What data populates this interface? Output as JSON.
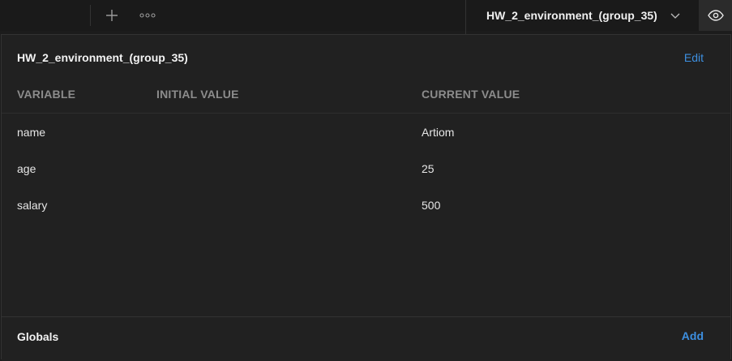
{
  "toolbar": {
    "new_tab_icon": "plus-icon",
    "more_icon": "more-horizontal-icon"
  },
  "environment_selector": {
    "selected": "HW_2_environment_(group_35)",
    "icon": "chevron-down-icon"
  },
  "quick_look": {
    "icon": "eye-icon"
  },
  "environment_panel": {
    "title": "HW_2_environment_(group_35)",
    "edit_label": "Edit",
    "columns": [
      "VARIABLE",
      "INITIAL VALUE",
      "CURRENT VALUE"
    ],
    "rows": [
      {
        "variable": "name",
        "initial_value": "",
        "current_value": "Artiom"
      },
      {
        "variable": "age",
        "initial_value": "",
        "current_value": "25"
      },
      {
        "variable": "salary",
        "initial_value": "",
        "current_value": "500"
      }
    ]
  },
  "globals": {
    "label": "Globals",
    "add_label": "Add"
  },
  "colors": {
    "accent": "#3d8fe0",
    "background": "#1c1c1c",
    "panel": "#212121"
  }
}
